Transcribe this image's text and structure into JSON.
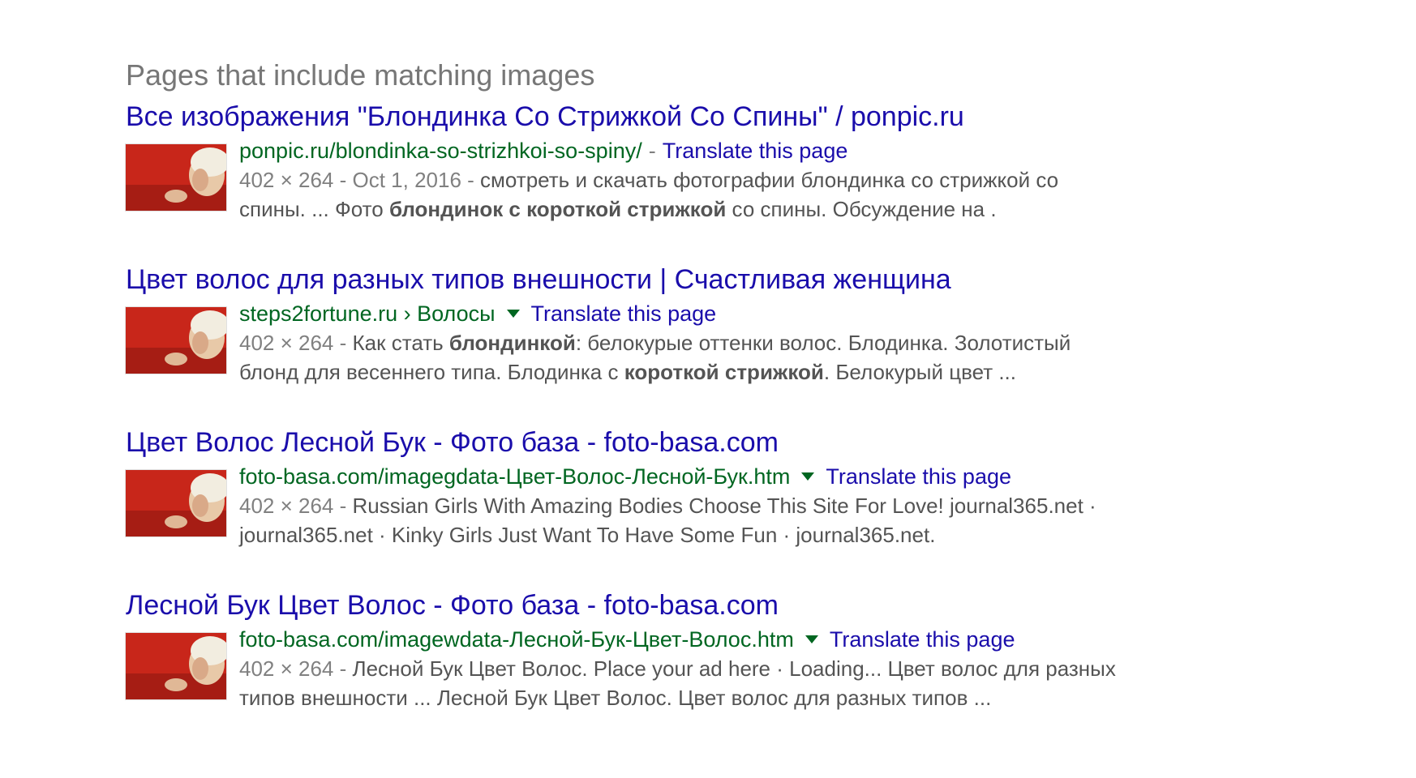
{
  "section": {
    "heading": "Pages that include matching images"
  },
  "results": [
    {
      "title": "Все изображения \"Блондинка Со Стрижкой Со Спины\" / ponpic.ru",
      "cite": "ponpic.ru/blondinka-so-strizhkoi-so-spiny/",
      "separator": "-",
      "translate": "Translate this page",
      "meta": "402 × 264 - Oct 1, 2016 -",
      "snippet": [
        {
          "text": " смотреть и скачать фотографии блондинка со стрижкой со спины. ... Фото ",
          "bold": false
        },
        {
          "text": "блондинок с короткой стрижкой",
          "bold": true
        },
        {
          "text": " со спины. Обсуждение на .",
          "bold": false
        }
      ]
    },
    {
      "title": "Цвет волос для разных типов внешности | Счастливая женщина",
      "cite": "steps2fortune.ru › Волосы",
      "translate": "Translate this page",
      "meta": "402 × 264 -",
      "snippet": [
        {
          "text": " Как стать ",
          "bold": false
        },
        {
          "text": "блондинкой",
          "bold": true
        },
        {
          "text": ": белокурые оттенки волос. Блодинка. Золотистый блонд для весеннего типа. Блодинка с ",
          "bold": false
        },
        {
          "text": "короткой стрижкой",
          "bold": true
        },
        {
          "text": ". Белокурый цвет ...",
          "bold": false
        }
      ]
    },
    {
      "title": "Цвет Волос Лесной Бук - Фото база - foto-basa.com",
      "cite": "foto-basa.com/imagegdata-Цвет-Волос-Лесной-Бук.htm",
      "translate": "Translate this page",
      "meta": "402 × 264 -",
      "snippet": [
        {
          "text": " Russian Girls With Amazing Bodies Choose This Site For Love! journal365.net · journal365.net · Kinky Girls Just Want To Have Some Fun · journal365.net.",
          "bold": false
        }
      ]
    },
    {
      "title": "Лесной Бук Цвет Волос - Фото база - foto-basa.com",
      "cite": "foto-basa.com/imagewdata-Лесной-Бук-Цвет-Волос.htm",
      "translate": "Translate this page",
      "meta": "402 × 264 -",
      "snippet": [
        {
          "text": " Лесной Бук Цвет Волос. Place your ad here · Loading... Цвет волос для разных типов внешности ... Лесной Бук Цвет Волос. Цвет волос для разных типов ...",
          "bold": false
        }
      ]
    }
  ],
  "colors": {
    "title_link": "#1a0dab",
    "cite_green": "#006621",
    "snippet_text": "#545454",
    "meta_gray": "#808080",
    "heading_gray": "#777777",
    "thumb_red": "#c8261a",
    "thumb_hair": "#f2ede0"
  }
}
